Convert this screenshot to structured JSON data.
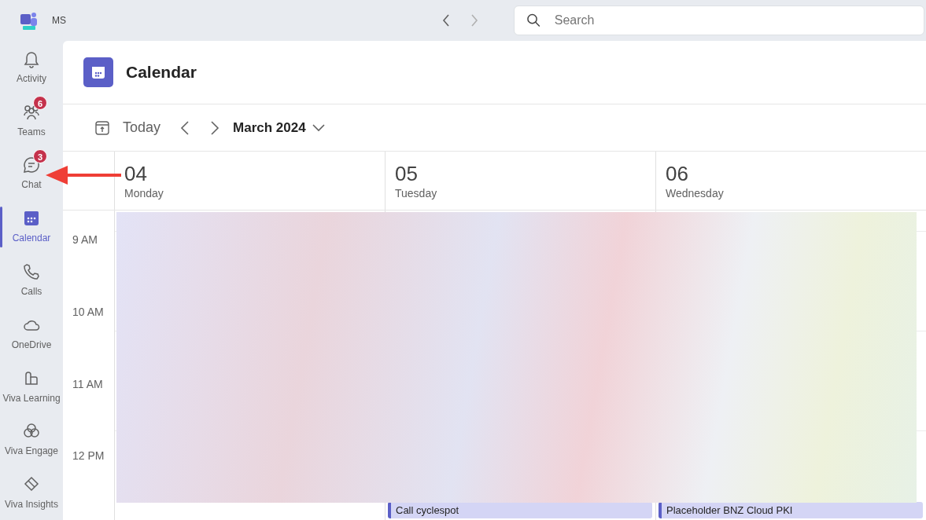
{
  "title_bar": {
    "account": "MS",
    "search": {
      "placeholder": "Search"
    }
  },
  "sidebar": {
    "items": [
      {
        "label": "Activity",
        "selected": false
      },
      {
        "label": "Teams",
        "selected": false,
        "badge": "6"
      },
      {
        "label": "Chat",
        "selected": false,
        "badge": "3"
      },
      {
        "label": "Calendar",
        "selected": true
      },
      {
        "label": "Calls",
        "selected": false
      },
      {
        "label": "OneDrive",
        "selected": false
      },
      {
        "label": "Viva Learning",
        "selected": false
      },
      {
        "label": "Viva Engage",
        "selected": false
      },
      {
        "label": "Viva Insights",
        "selected": false
      }
    ]
  },
  "page": {
    "title": "Calendar"
  },
  "toolbar": {
    "today": "Today",
    "month": "March 2024"
  },
  "days": [
    {
      "number": "04",
      "name": "Monday"
    },
    {
      "number": "05",
      "name": "Tuesday",
      "event": "Call cyclespot"
    },
    {
      "number": "06",
      "name": "Wednesday",
      "event": "Placeholder BNZ Cloud PKI"
    }
  ],
  "hours": [
    "9 AM",
    "10 AM",
    "11 AM",
    "12 PM"
  ]
}
